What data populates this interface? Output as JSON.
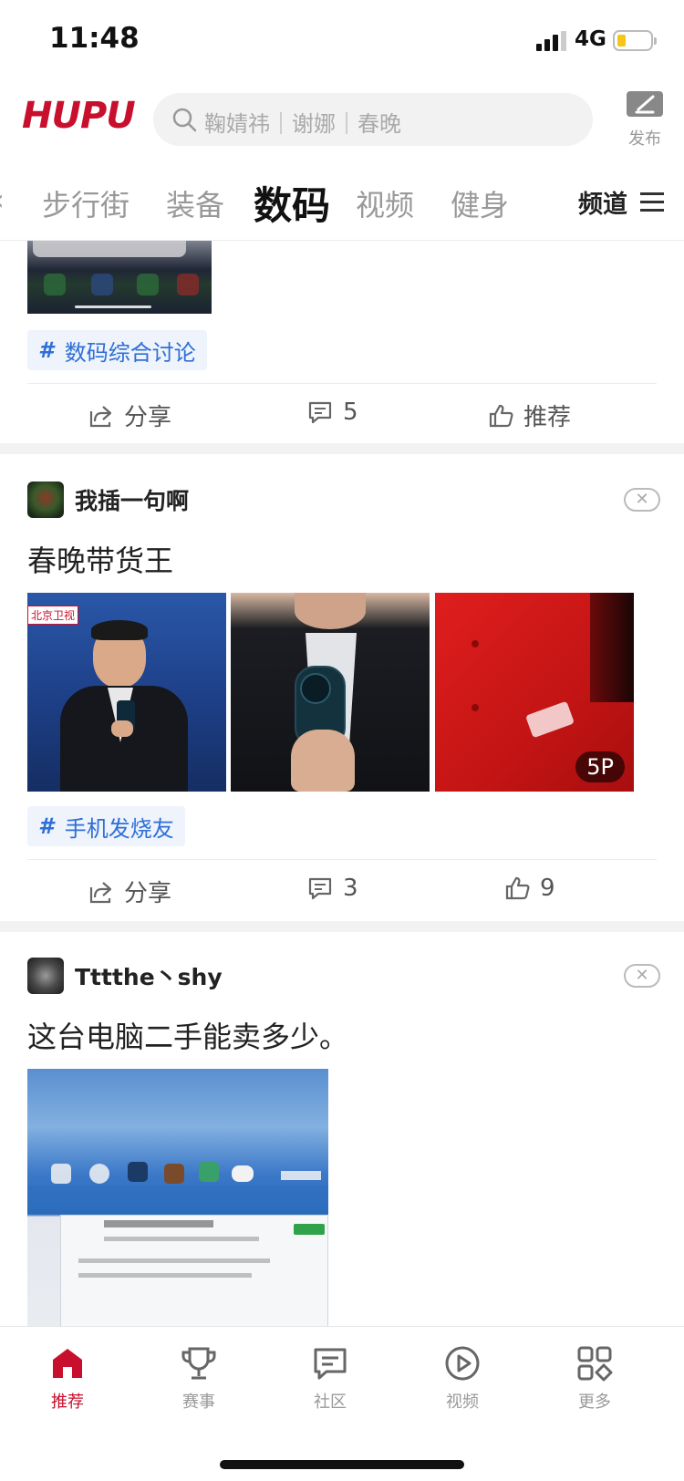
{
  "status_bar": {
    "time": "11:48",
    "network": "4G"
  },
  "header": {
    "logo": "HUPU",
    "search_placeholder": "鞠婧祎｜谢娜｜春晚",
    "publish_label": "发布"
  },
  "tabs": {
    "items": [
      "步行街",
      "装备",
      "数码",
      "视频",
      "健身"
    ],
    "active": "数码",
    "more_label": "频道"
  },
  "posts": [
    {
      "topic": "数码综合讨论",
      "share_label": "分享",
      "comments": "5",
      "recommend_label": "推荐"
    },
    {
      "author": "我插一句啊",
      "title": "春晚带货王",
      "image_count_badge": "5P",
      "topic": "手机发烧友",
      "share_label": "分享",
      "comments": "3",
      "likes": "9"
    },
    {
      "author": "Tttthe丶shy",
      "title": "这台电脑二手能卖多少。"
    }
  ],
  "bottom_nav": [
    {
      "label": "推荐",
      "icon": "home-icon",
      "active": true
    },
    {
      "label": "赛事",
      "icon": "trophy-icon"
    },
    {
      "label": "社区",
      "icon": "chat-icon"
    },
    {
      "label": "视频",
      "icon": "play-icon"
    },
    {
      "label": "更多",
      "icon": "grid-icon"
    }
  ],
  "colors": {
    "brand": "#c8102e",
    "topic": "#2f6fd6"
  }
}
